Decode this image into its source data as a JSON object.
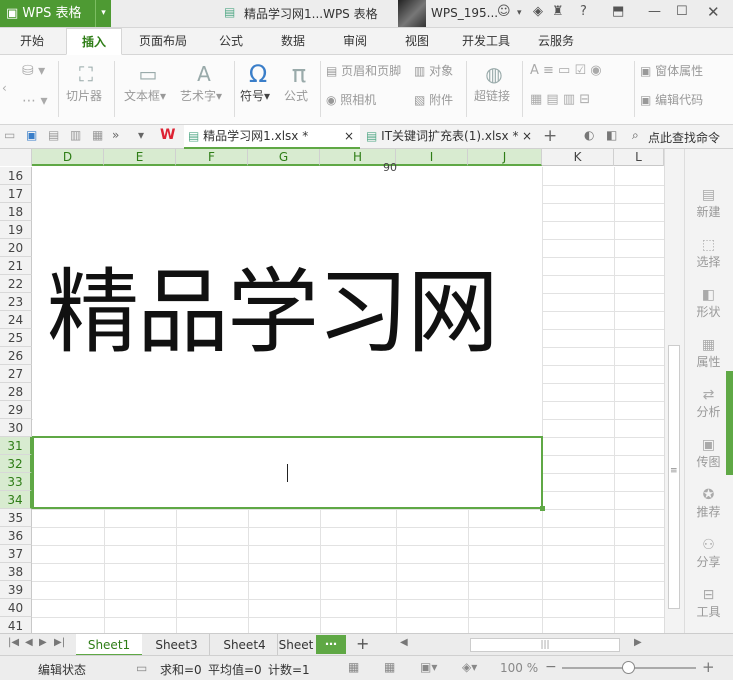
{
  "titlebar": {
    "app_name": "WPS 表格",
    "document_title": "精品学习网1...WPS 表格",
    "user_name": "WPS_195..."
  },
  "ribbon_tabs": [
    "开始",
    "插入",
    "页面布局",
    "公式",
    "数据",
    "审阅",
    "视图",
    "开发工具",
    "云服务"
  ],
  "ribbon": {
    "slicer": "切片器",
    "textbox": "文本框",
    "wordart": "艺术字",
    "symbol": "符号",
    "formula": "公式",
    "header_footer": "页眉和页脚",
    "camera": "照相机",
    "object": "对象",
    "attachment": "附件",
    "hyperlink": "超链接",
    "form_properties": "窗体属性",
    "edit_code": "编辑代码"
  },
  "doc_tabs": [
    {
      "name": "精品学习网1.xlsx *"
    },
    {
      "name": "IT关键词扩充表(1).xlsx *"
    }
  ],
  "find_command": "点此查找命令",
  "columns": [
    "D",
    "E",
    "F",
    "G",
    "H",
    "I",
    "J",
    "K",
    "L"
  ],
  "rows": [
    "16",
    "17",
    "18",
    "19",
    "20",
    "21",
    "22",
    "23",
    "24",
    "25",
    "26",
    "27",
    "28",
    "29",
    "30",
    "31",
    "32",
    "33",
    "34",
    "35",
    "36",
    "37",
    "38",
    "39",
    "40",
    "41"
  ],
  "cell_snippet": "90",
  "wordart_text": "精品学习网",
  "sidebar": [
    "新建",
    "选择",
    "形状",
    "属性",
    "分析",
    "传图",
    "推荐",
    "分享",
    "工具"
  ],
  "sheets": [
    "Sheet1",
    "Sheet3",
    "Sheet4",
    "Sheet"
  ],
  "status": {
    "edit_state": "编辑状态",
    "sum": "求和=0",
    "average": "平均值=0",
    "count": "计数=1",
    "zoom": "100 %"
  }
}
